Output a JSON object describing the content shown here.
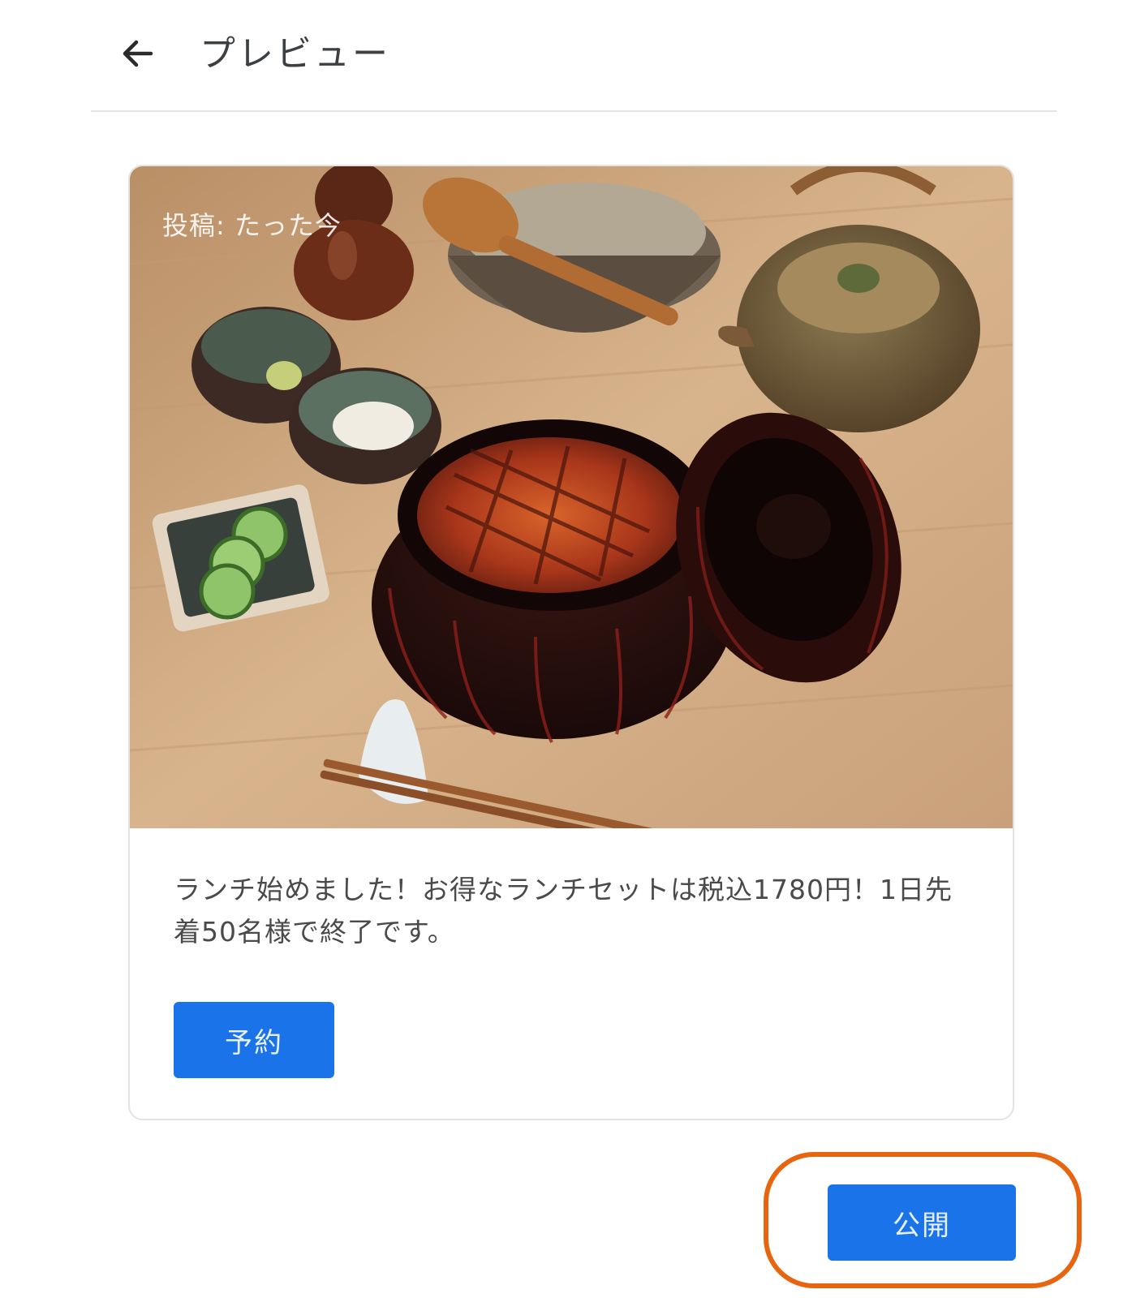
{
  "header": {
    "title": "プレビュー"
  },
  "post": {
    "posted_label": "投稿: たった今",
    "body": "ランチ始めました！お得なランチセットは税込1780円！1日先着50名様で終了です。",
    "cta_label": "予約"
  },
  "actions": {
    "publish_label": "公開"
  },
  "colors": {
    "primary": "#1a73e8",
    "highlight": "#e8650f",
    "divider": "#e3e3e3"
  },
  "icons": {
    "back": "arrow-left-icon"
  }
}
